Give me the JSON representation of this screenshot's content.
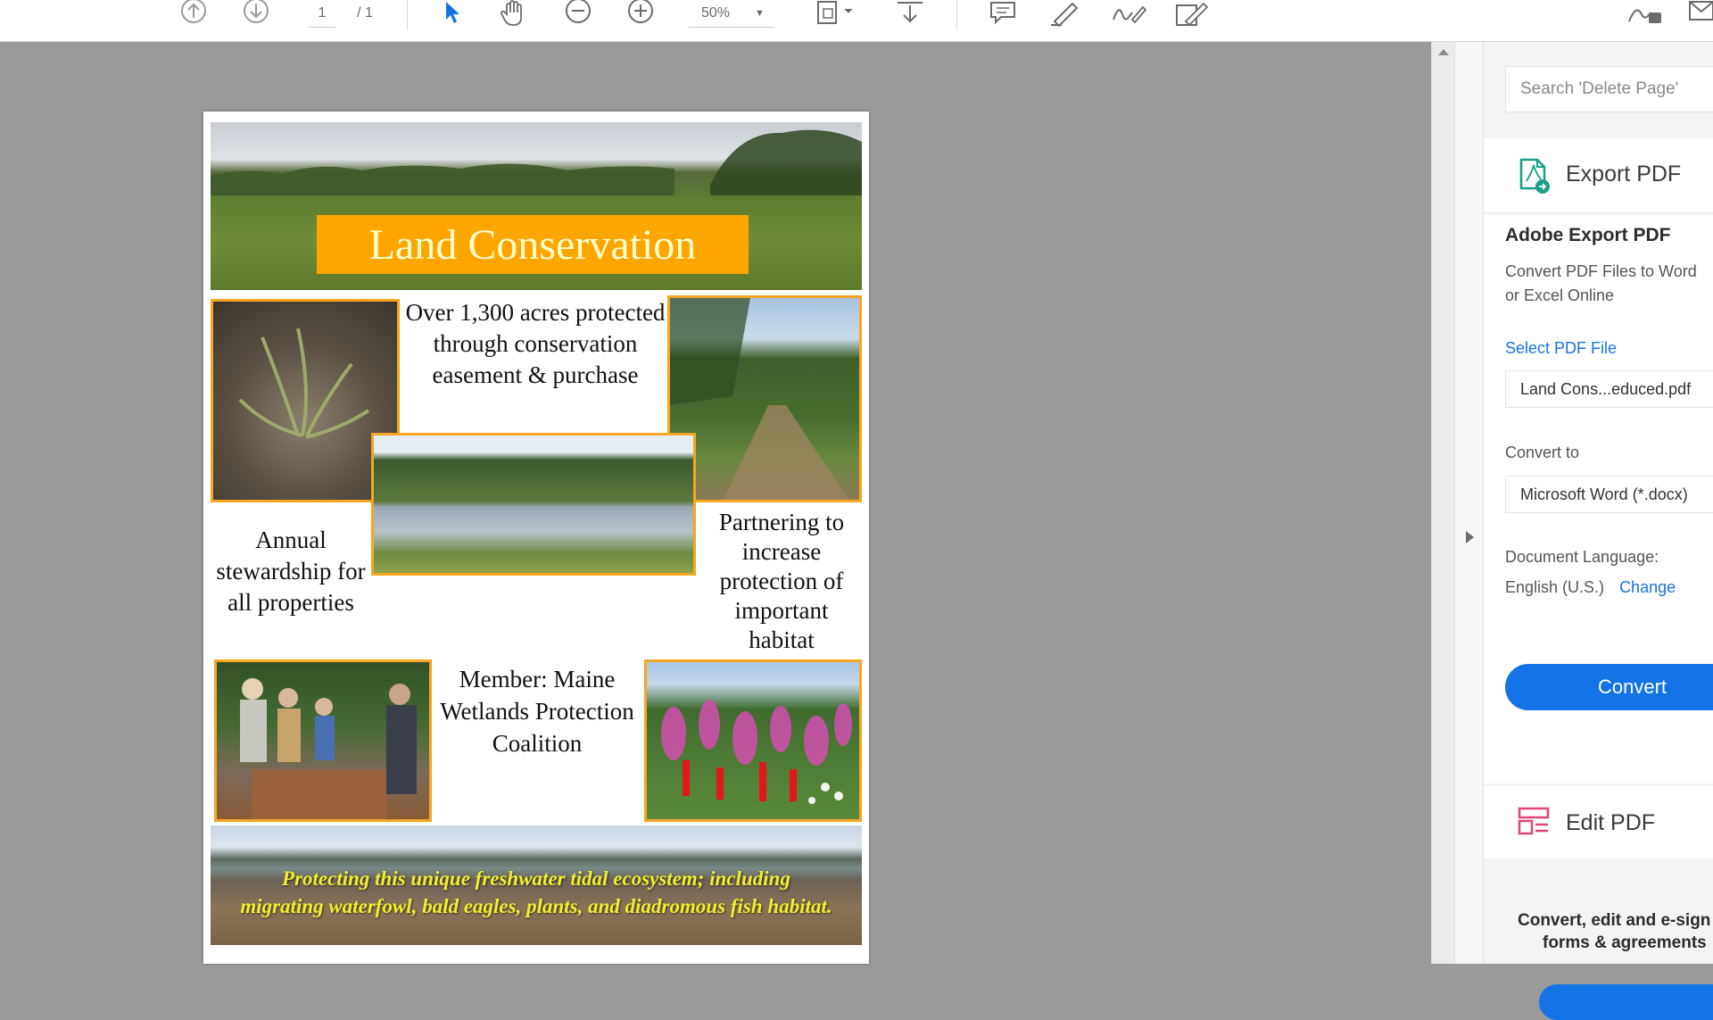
{
  "toolbar": {
    "page_current": "1",
    "page_total": "/ 1",
    "zoom": "50%",
    "icons": [
      "prev-page-icon",
      "next-page-icon",
      "select-cursor-icon",
      "hand-tool-icon",
      "zoom-out-icon",
      "zoom-in-icon",
      "page-fit-icon",
      "scroll-mode-icon",
      "comment-icon",
      "highlight-icon",
      "sign-icon",
      "edit-text-icon",
      "share-icon",
      "email-icon"
    ]
  },
  "document": {
    "title": "Land Conservation",
    "text_acres": "Over 1,300 acres protected through conservation easement & purchase",
    "text_stewardship": "Annual stewardship for all properties",
    "text_partnering": "Partnering to increase protection of important habitat",
    "text_member": "Member: Maine Wetlands Protection Coalition",
    "text_footer": "Protecting this unique freshwater tidal ecosystem; including migrating waterfowl, bald eagles, plants, and diadromous fish habitat.",
    "accent_color": "#f5a623"
  },
  "right_pane": {
    "search_placeholder": "Search 'Delete Page'",
    "export_tool_label": "Export PDF",
    "export_heading": "Adobe Export PDF",
    "export_desc_line1": "Convert PDF Files to Word",
    "export_desc_line2": "or Excel Online",
    "select_file_label": "Select PDF File",
    "selected_file": "Land Cons...educed.pdf",
    "convert_to_label": "Convert to",
    "convert_to_value": "Microsoft Word (*.docx)",
    "doc_language_label": "Document Language:",
    "doc_language_value": "English (U.S.)",
    "change_link": "Change",
    "convert_button": "Convert",
    "edit_tool_label": "Edit PDF",
    "promo_line1": "Convert, edit and e-sign",
    "promo_line2": "forms & agreements",
    "brand_blue": "#1473e6"
  }
}
